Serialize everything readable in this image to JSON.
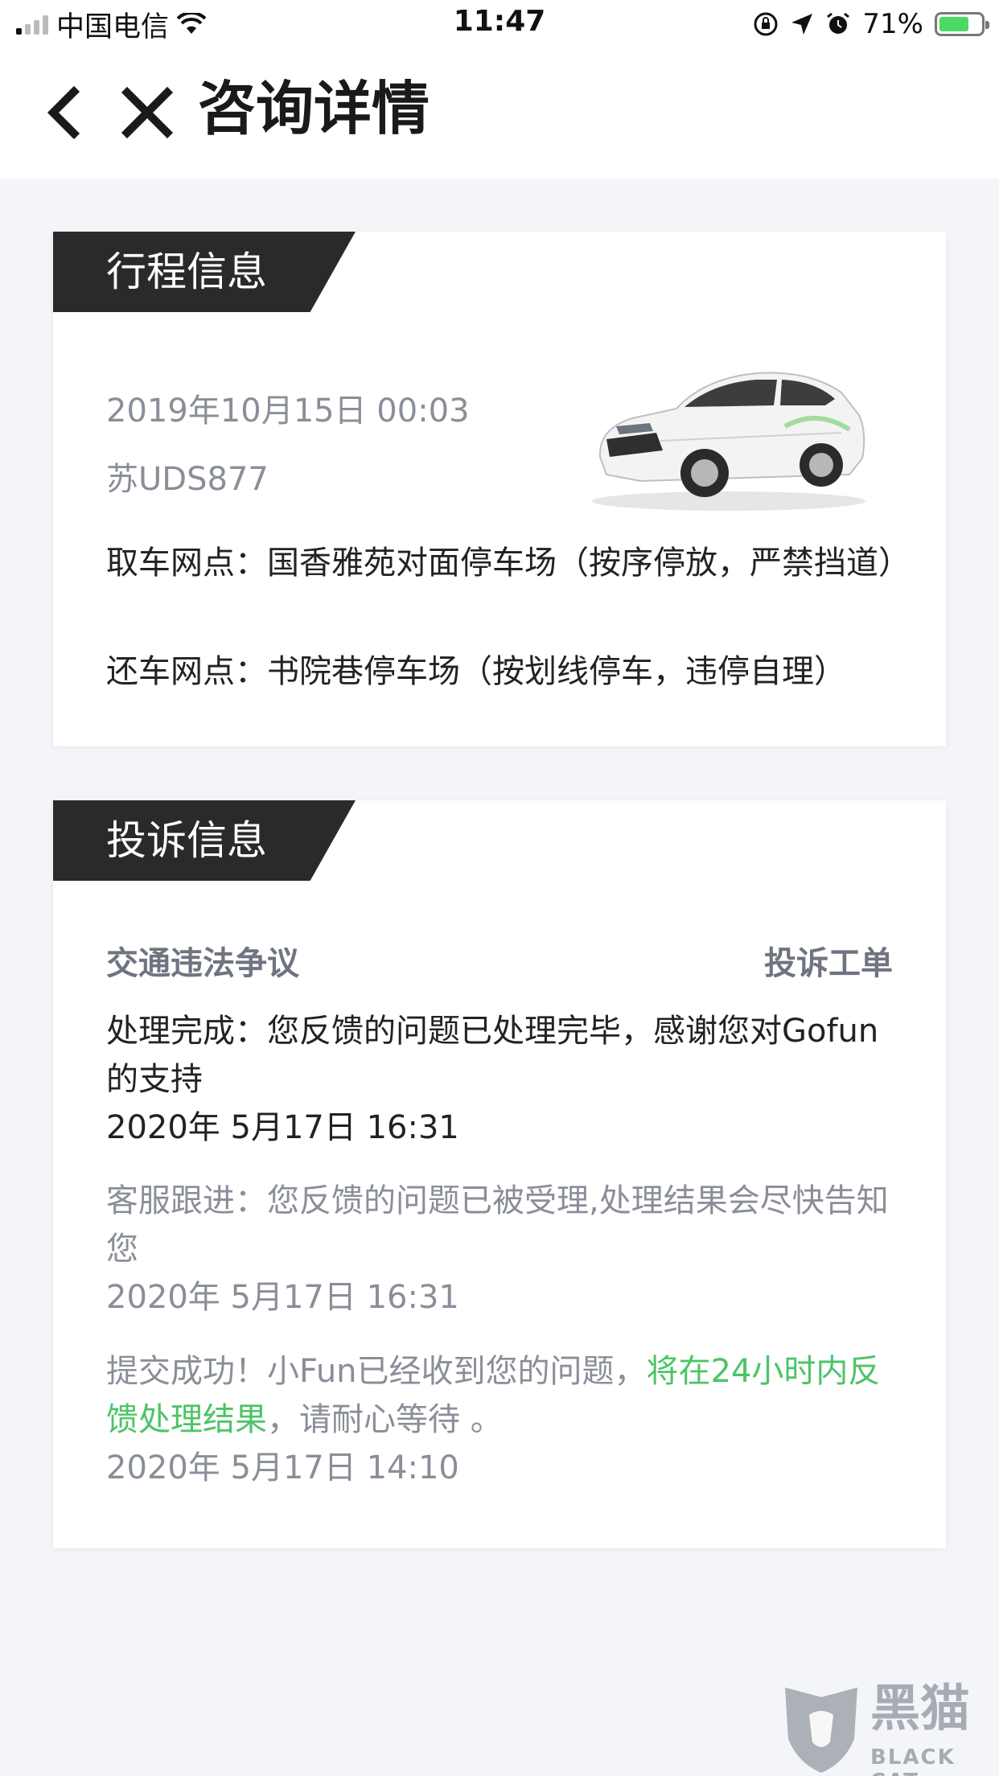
{
  "status_bar": {
    "carrier": "中国电信",
    "time": "11:47",
    "battery_percent": "71%",
    "battery_level": 0.71,
    "icons": [
      "signal-icon",
      "wifi-icon",
      "orientation-lock-icon",
      "location-icon",
      "alarm-icon",
      "battery-icon"
    ]
  },
  "nav": {
    "title": "咨询详情",
    "back_icon": "chevron-left-icon",
    "close_icon": "close-icon"
  },
  "trip": {
    "section_title": "行程信息",
    "datetime": "2019年10月15日 00:03",
    "plate": "苏UDS877",
    "pickup": "取车网点：国香雅苑对面停车场（按序停放，严禁挡道）",
    "return": "还车网点：书院巷停车场（按划线停车，违停自理）"
  },
  "complaint": {
    "section_title": "投诉信息",
    "category": "交通违法争议",
    "type": "投诉工单",
    "entries": [
      {
        "text": "处理完成：您反馈的问题已处理完毕，感谢您对Gofun的支持",
        "time": "2020年 5月17日 16:31"
      },
      {
        "text": "客服跟进：您反馈的问题已被受理,处理结果会尽快告知您",
        "time": "2020年 5月17日 16:31"
      },
      {
        "text_before": "提交成功！小Fun已经收到您的问题，",
        "text_highlight": "将在24小时内反馈处理结果",
        "text_after": "，请耐心等待 。",
        "time": "2020年 5月17日 14:10"
      }
    ]
  },
  "colors": {
    "accent_green": "#4cc466",
    "tag_dark": "#2a2a2a",
    "background": "#f4f5f9",
    "muted_text": "#8a8e98"
  },
  "watermark": {
    "text": "黑猫",
    "sub": "BLACK CAT"
  }
}
